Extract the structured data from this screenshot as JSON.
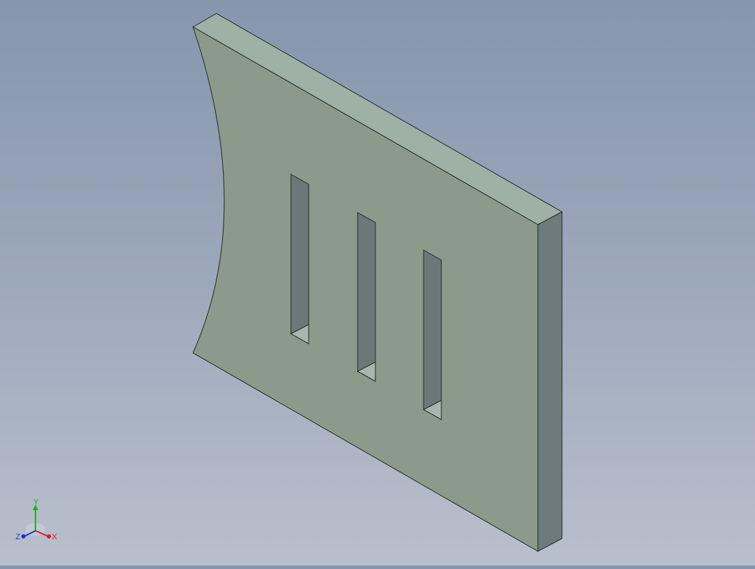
{
  "viewport": {
    "background_top": "#8796ad",
    "background_bottom": "#b9bfcc"
  },
  "part": {
    "face_color": "#8c9a8b",
    "top_edge_color": "#9fb0a5",
    "side_color": "#6e7b7c",
    "slot_inner_color": "#6c7878",
    "slot_floor_color": "#a7b7ae",
    "slot_count": 3
  },
  "triad": {
    "x_label": "X",
    "y_label": "Y",
    "z_label": "Z",
    "x_color": "#d42020",
    "y_color": "#22b022",
    "z_color": "#2030d0"
  }
}
